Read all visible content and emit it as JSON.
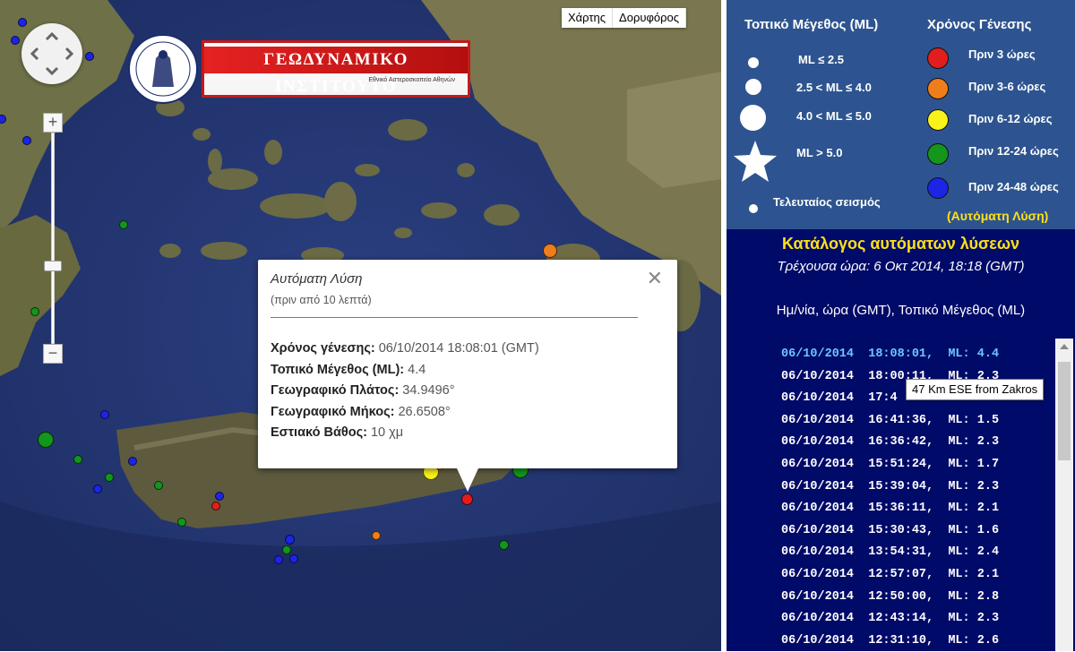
{
  "map": {
    "maptype_buttons": [
      "Χάρτης",
      "Δορυφόρος"
    ],
    "logo": {
      "title": "ΓΕΩΔΥΝΑΜΙΚΟ ΙΝΣΤΙΤΟΥΤΟ",
      "subtitle": "Εθνικό Αστεροσκοπείο Αθηνών",
      "seal_text": "ΕΘΝΙΚΟ ΑΣΤΕΡΟΣΚΟΠΕΙΟ ΑΘΗΝΩΝ"
    },
    "popup": {
      "title": "Αυτόματη Λύση",
      "subtitle": "(πριν από 10 λεπτά)",
      "rows": [
        {
          "label": "Χρόνος γένεσης",
          "value": "06/10/2014  18:08:01 (GMT)"
        },
        {
          "label": "Τοπικό Μέγεθος (ML)",
          "value": "4.4"
        },
        {
          "label": "Γεωγραφικό Πλάτος",
          "value": "34.9496°"
        },
        {
          "label": "Γεωγραφικό Μήκος",
          "value": "26.6508°"
        },
        {
          "label": "Εστιακό Βάθος",
          "value": "10 χμ"
        }
      ]
    }
  },
  "legend": {
    "magnitude_heading": "Τοπικό Μέγεθος (ML)",
    "time_heading": "Χρόνος Γένεσης",
    "magnitude_items": [
      "ML ≤ 2.5",
      "2.5 < ML ≤ 4.0",
      "4.0 < ML ≤ 5.0",
      "ML > 5.0"
    ],
    "last_quake": "Τελευταίος σεισμός",
    "time_items": [
      {
        "label": "Πριν 3 ώρες",
        "color": "#e21d1d"
      },
      {
        "label": "Πριν 3-6 ώρες",
        "color": "#f07d1c"
      },
      {
        "label": "Πριν 6-12 ώρες",
        "color": "#f7f21a"
      },
      {
        "label": "Πριν 12-24 ώρες",
        "color": "#13961b"
      },
      {
        "label": "Πριν 24-48 ώρες",
        "color": "#1c24e6"
      }
    ],
    "auto_note": "(Αυτόματη Λύση)"
  },
  "catalog": {
    "title": "Κατάλογος αυτόματων λύσεων",
    "current_time": "Τρέχουσα ώρα: 6 Οκτ 2014, 18:18 (GMT)",
    "columns": "Ημ/νία, ώρα (GMT), Τοπικό Μέγεθος (ML)",
    "rows": [
      "06/10/2014  18:08:01,  ML: 4.4",
      "06/10/2014  18:00:11,  ML: 2.3",
      "06/10/2014  17:4",
      "06/10/2014  16:41:36,  ML: 1.5",
      "06/10/2014  16:36:42,  ML: 2.3",
      "06/10/2014  15:51:24,  ML: 1.7",
      "06/10/2014  15:39:04,  ML: 2.3",
      "06/10/2014  15:36:11,  ML: 2.1",
      "06/10/2014  15:30:43,  ML: 1.6",
      "06/10/2014  13:54:31,  ML: 2.4",
      "06/10/2014  12:57:07,  ML: 2.1",
      "06/10/2014  12:50:00,  ML: 2.8",
      "06/10/2014  12:43:14,  ML: 2.3",
      "06/10/2014  12:31:10,  ML: 2.6"
    ],
    "tooltip": "47 Km ESE from Zakros"
  }
}
